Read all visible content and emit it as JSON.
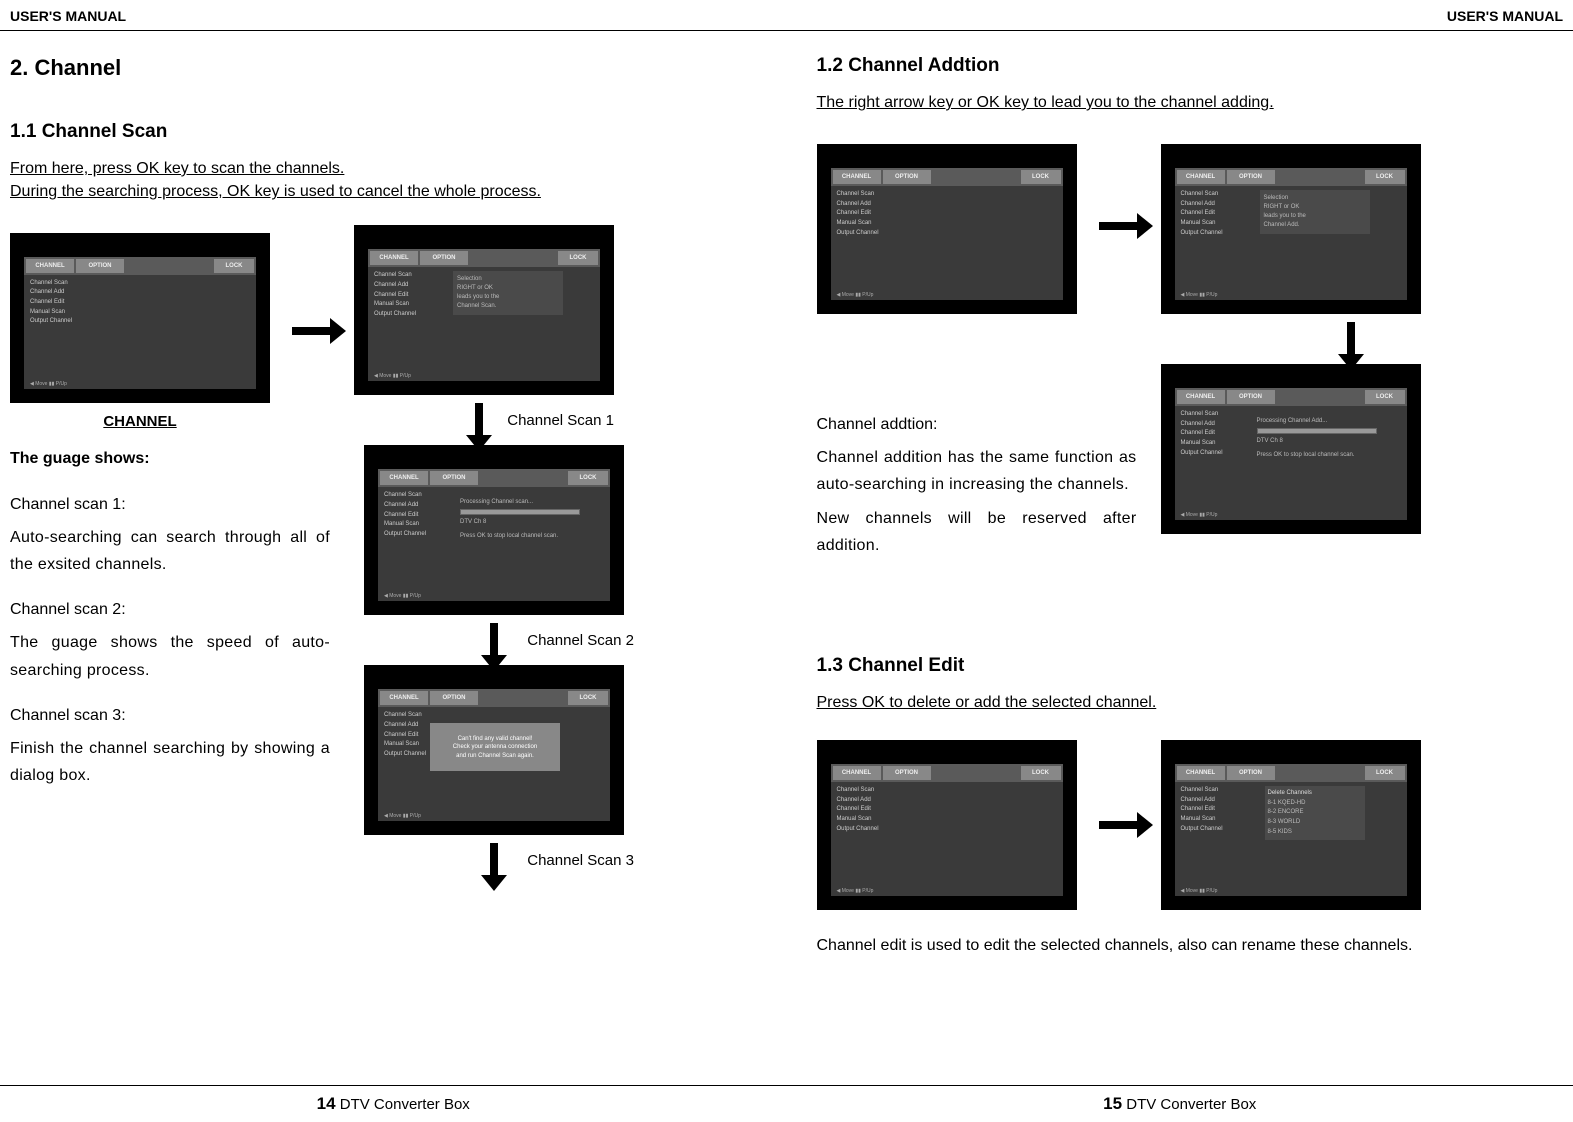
{
  "header": {
    "left": "USER'S MANUAL",
    "right": "USER'S MANUAL"
  },
  "left": {
    "title": "2. Channel",
    "s11": {
      "heading": "1.1 Channel Scan",
      "intro1": "From here, press OK key to scan the channels.",
      "intro2": "During the searching process, OK key is used to cancel the whole process.",
      "channel_label": "CHANNEL",
      "scan1_label": "Channel Scan 1",
      "scan2_label": "Channel Scan 2",
      "scan3_label": "Channel Scan 3",
      "guage_heading": "The guage shows:",
      "cs1_title": "Channel scan 1:",
      "cs1_body": "Auto-searching can search through all of the exsited channels.",
      "cs2_title": "Channel scan 2:",
      "cs2_body": "The guage shows the speed of auto-searching process.",
      "cs3_title": "Channel scan 3:",
      "cs3_body": "Finish the channel searching by showing a dialog box."
    }
  },
  "right": {
    "s12": {
      "heading": "1.2 Channel Addtion",
      "intro": " The right arrow key or OK key to lead you to the channel adding.",
      "addtion_title": "Channel addtion:",
      "p1": "Channel addition has the same function as auto-searching in increasing the channels.",
      "p2": "New channels will be reserved after addition."
    },
    "s13": {
      "heading": "1.3 Channel Edit",
      "intro": "Press OK to delete or add the selected channel.",
      "footnote": "Channel edit is used to edit the selected channels, also can rename these channels."
    }
  },
  "osd": {
    "tabs": {
      "channel": "CHANNEL",
      "option": "OPTION",
      "lock": "LOCK"
    },
    "menu": [
      "Channel Scan",
      "Channel Add",
      "Channel Edit",
      "Manual Scan",
      "Output Channel"
    ],
    "foot": "◀ Move  ▮▮ P/Up",
    "hint_scan": "Selection\nRIGHT or OK\nleads you to the\nChannel Scan.",
    "hint_add": "Selection\nRIGHT or OK\nleads you to the\nChannel Add.",
    "progress_title": "Processing Channel scan...",
    "progress_ch": "DTV Ch 8",
    "progress_hint": "Press OK to stop local channel scan.",
    "progress_add_title": "Processing Channel Add...",
    "dialog_line1": "Can't find any valid channel!",
    "dialog_line2": "Check your antenna connection",
    "dialog_line3": "and run Channel Scan again.",
    "edit_header": "Delete Channels",
    "edit_rows": [
      "8-1   KQED-HD",
      "8-2   ENCORE",
      "8-3   WORLD",
      "8-5   KIDS"
    ]
  },
  "footer": {
    "left_num": "14",
    "right_num": "15",
    "product": "DTV Converter Box"
  }
}
